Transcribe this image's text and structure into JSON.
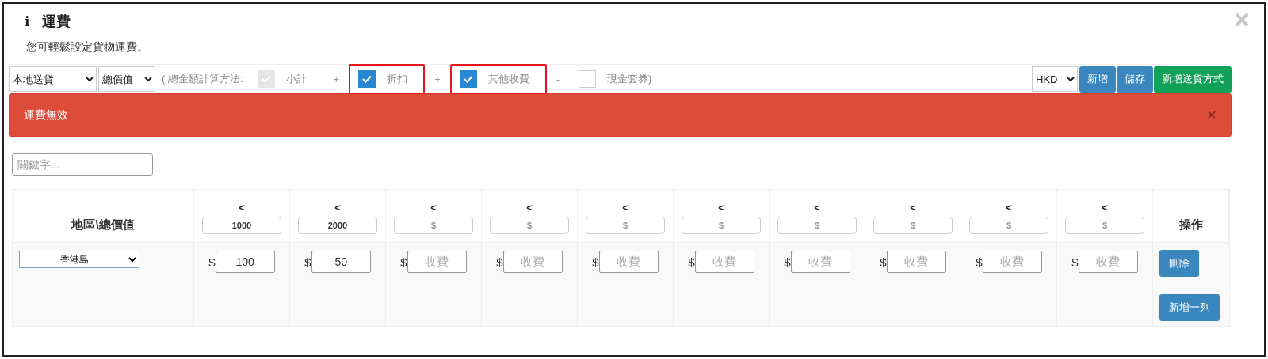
{
  "dialog": {
    "icon": "i",
    "title": "運費",
    "subtitle": "您可輕鬆設定貨物運費。"
  },
  "toolbar": {
    "delivery_select": "本地送貨",
    "basis_select": "總價值",
    "formula_prefix": "( 總金額計算方法:",
    "terms": [
      {
        "label": "小計",
        "checked": true,
        "disabled": true,
        "highlighted": false
      },
      {
        "operator": "+",
        "label": "折扣",
        "checked": true,
        "disabled": false,
        "highlighted": true
      },
      {
        "operator": "+",
        "label": "其他收費",
        "checked": true,
        "disabled": false,
        "highlighted": true
      },
      {
        "operator": "-",
        "label": "現金套券)",
        "checked": false,
        "disabled": false,
        "highlighted": false
      }
    ],
    "currency_select": "HKD",
    "buttons": [
      {
        "label": "新增",
        "kind": "primary"
      },
      {
        "label": "儲存",
        "kind": "primary"
      },
      {
        "label": "新增送貨方式",
        "kind": "success"
      }
    ]
  },
  "alert": {
    "text": "運費無效",
    "close": "×"
  },
  "search": {
    "placeholder": "關鍵字..."
  },
  "table": {
    "region_header": "地區\\總價值",
    "action_header": "操作",
    "thresholds": [
      {
        "symbol": "<",
        "value": "1000"
      },
      {
        "symbol": "<",
        "value": "2000"
      },
      {
        "symbol": "<",
        "placeholder": "$"
      },
      {
        "symbol": "<",
        "placeholder": "$"
      },
      {
        "symbol": "<",
        "placeholder": "$"
      },
      {
        "symbol": "<",
        "placeholder": "$"
      },
      {
        "symbol": "<",
        "placeholder": "$"
      },
      {
        "symbol": "<",
        "placeholder": "$"
      },
      {
        "symbol": "<",
        "placeholder": "$"
      },
      {
        "symbol": "<",
        "placeholder": "$"
      }
    ],
    "rows": [
      {
        "region": "香港島",
        "currency": "$",
        "fees": [
          {
            "value": "100"
          },
          {
            "value": "50"
          },
          {
            "placeholder": "收費"
          },
          {
            "placeholder": "收費"
          },
          {
            "placeholder": "收費"
          },
          {
            "placeholder": "收費"
          },
          {
            "placeholder": "收費"
          },
          {
            "placeholder": "收費"
          },
          {
            "placeholder": "收費"
          },
          {
            "placeholder": "收費"
          }
        ],
        "actions": [
          {
            "label": "刪除",
            "kind": "primary"
          },
          {
            "label": "新增一列",
            "kind": "primary"
          }
        ]
      }
    ]
  }
}
